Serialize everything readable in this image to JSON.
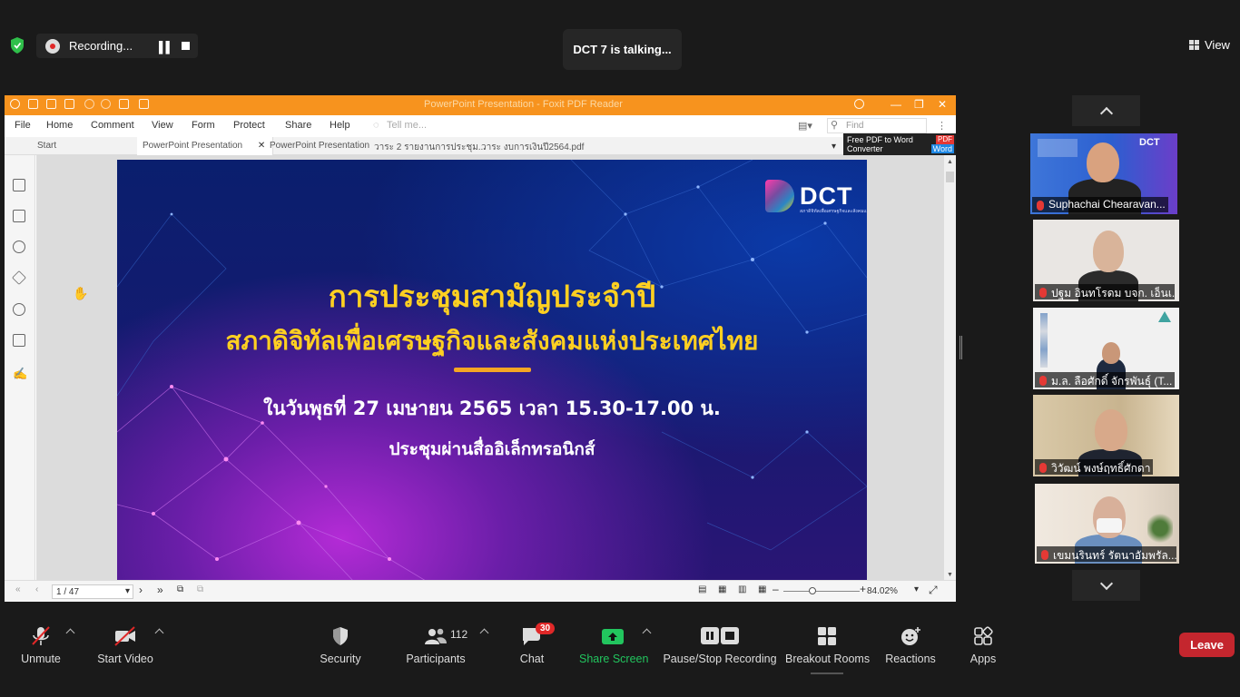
{
  "recording": {
    "label": "Recording..."
  },
  "talking": {
    "text": "DCT  7 is talking..."
  },
  "view": {
    "label": "View"
  },
  "app": {
    "title": "PowerPoint Presentation - Foxit PDF Reader",
    "menu": [
      "File",
      "Home",
      "Comment",
      "View",
      "Form",
      "Protect",
      "Share",
      "Help"
    ],
    "tell_me": "Tell me...",
    "find_placeholder": "Find",
    "tabs": [
      "Start",
      "PowerPoint Presentation",
      "PowerPoint Presentation",
      "วาระ 2 รายงานการประชุม...",
      "วาระ งบการเงินปี2564.pdf"
    ],
    "banner": {
      "line1": "Free PDF to Word",
      "line2": "Converter",
      "pdf": "PDF",
      "word": "Word"
    },
    "page_indicator": "1 / 47",
    "zoom": "84.02%"
  },
  "slide": {
    "logo": "DCT",
    "logo_sub": "สภาดิจิทัลเพื่อเศรษฐกิจและสังคมแห่งประเทศไทย",
    "title1": "การประชุมสามัญประจำปี",
    "title2": "สภาดิจิทัลเพื่อเศรษฐกิจและสังคมแห่งประเทศไทย",
    "date": "ในวันพุธที่ 27 เมษายน 2565 เวลา 15.30-17.00 น.",
    "mode": "ประชุมผ่านสื่ออิเล็กทรอนิกส์"
  },
  "participants_tiles": [
    {
      "name": "Suphachai Chearavan..."
    },
    {
      "name": "ปฐม อินทโรดม บจก. เอ็นเ..."
    },
    {
      "name": "ม.ล. ลือศักดิ์ จักรพันธุ์ (T..."
    },
    {
      "name": "วิวัฒน์ พงษ์ฤทธิ์ศักดา"
    },
    {
      "name": "เขมนรินทร์ รัตนาอัมพรัล..."
    }
  ],
  "toolbar": {
    "unmute": "Unmute",
    "start_video": "Start Video",
    "security": "Security",
    "participants": "Participants",
    "participants_count": "112",
    "chat": "Chat",
    "chat_badge": "30",
    "share_screen": "Share Screen",
    "pause_stop": "Pause/Stop Recording",
    "breakout": "Breakout Rooms",
    "reactions": "Reactions",
    "apps": "Apps",
    "leave": "Leave"
  },
  "colors": {
    "accent_orange": "#f7931e",
    "share_green": "#22c55e",
    "leave_red": "#c4262e",
    "slide_title_yellow": "#ffd021"
  }
}
